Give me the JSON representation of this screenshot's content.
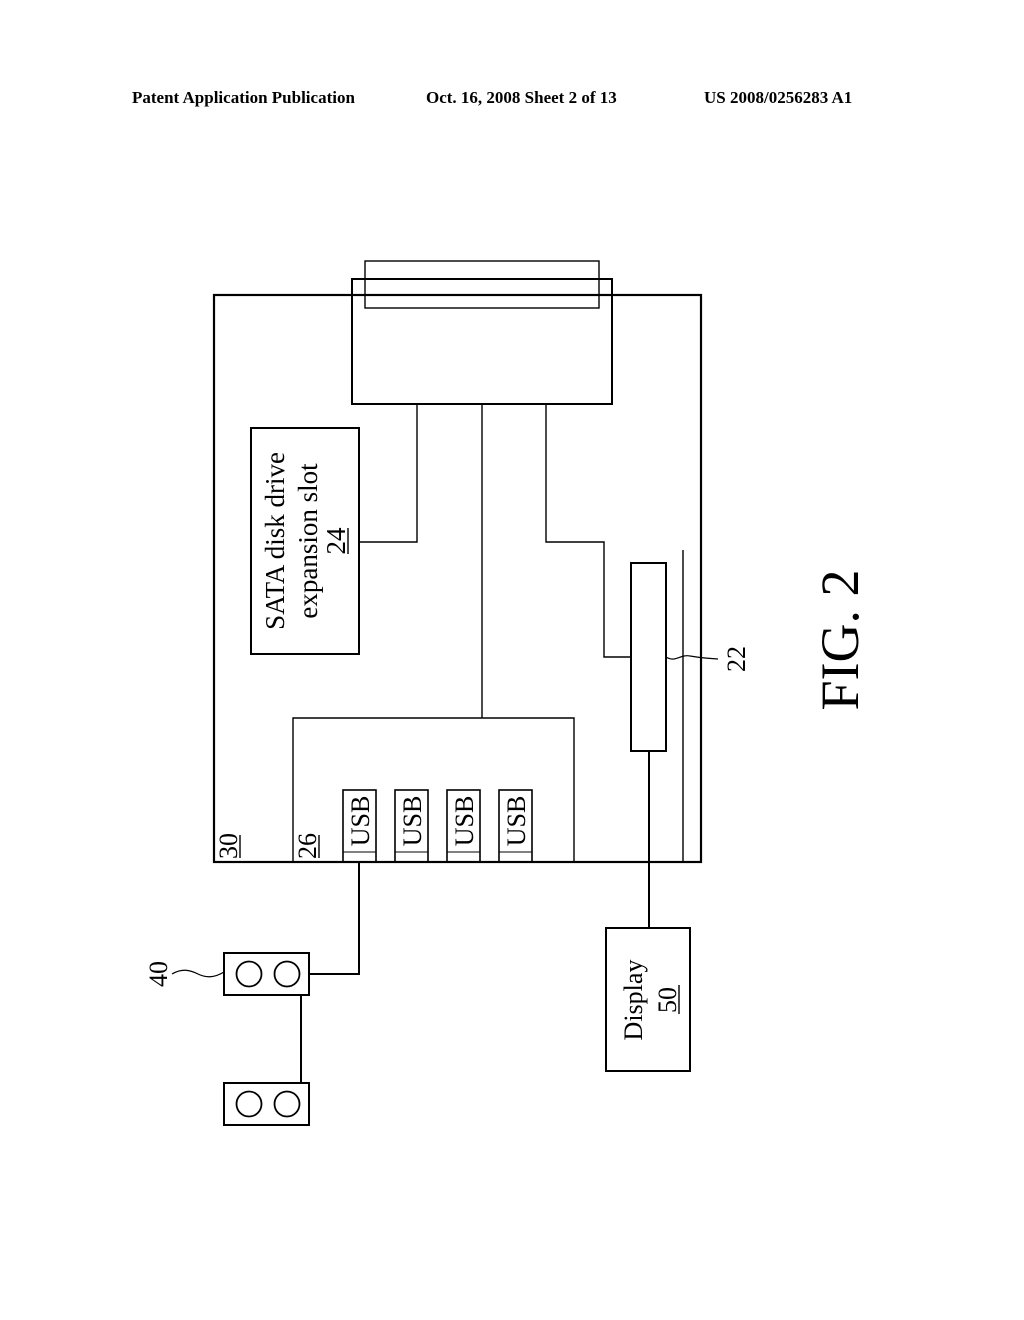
{
  "header": {
    "left": "Patent Application Publication",
    "middle": "Oct. 16, 2008   Sheet 2 of 13",
    "right": "US 2008/0256283 A1"
  },
  "figure": {
    "caption": "FIG. 2",
    "board": {
      "ref": "30"
    },
    "sata_slot": {
      "line1": "SATA disk drive",
      "line2": "expansion slot",
      "ref": "24"
    },
    "usb_hub": {
      "ref": "26",
      "ports": [
        "USB",
        "USB",
        "USB",
        "USB"
      ]
    },
    "video_chip": {
      "ref": "22"
    },
    "peripheral": {
      "ref": "40"
    },
    "display": {
      "label": "Display",
      "ref": "50"
    }
  }
}
